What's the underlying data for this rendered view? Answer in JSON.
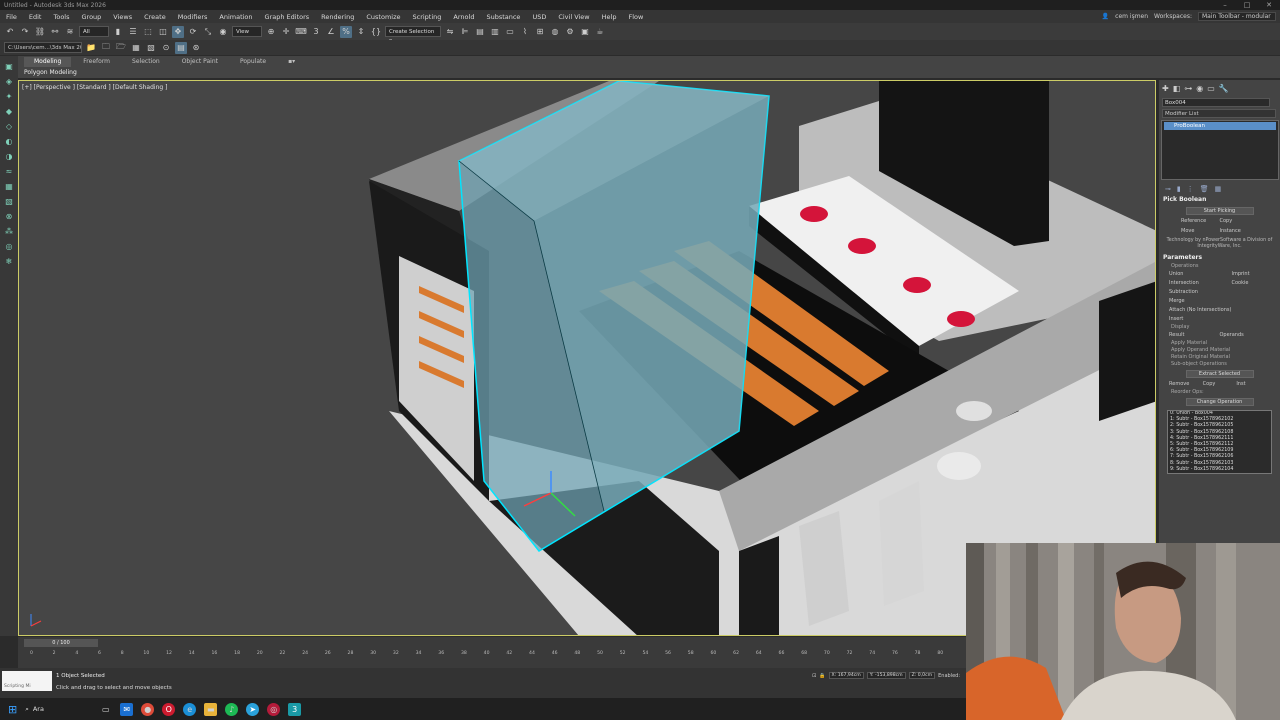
{
  "window": {
    "title": "Untitled - Autodesk 3ds Max 2026",
    "controls": [
      "–",
      "□",
      "✕"
    ]
  },
  "menu": {
    "items": [
      "File",
      "Edit",
      "Tools",
      "Group",
      "Views",
      "Create",
      "Modifiers",
      "Animation",
      "Graph Editors",
      "Rendering",
      "Customize",
      "Scripting",
      "Arnold",
      "Substance",
      "USD",
      "Civil View",
      "Help",
      "Flow"
    ],
    "user": "cem işmen",
    "workspaces_label": "Workspaces:",
    "workspace": "Main Toolbar - modular"
  },
  "toolbar": {
    "filter": "All",
    "ref_coord": "View",
    "selection_set": "Create Selection Se"
  },
  "toolbar2": {
    "path": "C:\\Users\\cem...\\3ds Max 2026"
  },
  "ribbon": {
    "tabs": [
      "Modeling",
      "Freeform",
      "Selection",
      "Object Paint",
      "Populate"
    ],
    "sub_label": "Polygon Modeling"
  },
  "viewport": {
    "label": "[+] [Perspective ] [Standard ] [Default Shading ]"
  },
  "command_panel": {
    "object_name": "Box004",
    "modifier_list": "Modifier List",
    "stack_item": "ProBoolean",
    "pick_boolean": {
      "title": "Pick Boolean",
      "start_picking": "Start Picking",
      "options": [
        "Reference",
        "Copy",
        "Move",
        "Instance"
      ],
      "note": "Technology by nPowerSoftware a Division of IntegrityWare, Inc."
    },
    "parameters": {
      "title": "Parameters",
      "operations_label": "Operations",
      "operations": [
        "Union",
        "Imprint",
        "Intersection",
        "Cookie",
        "Subtraction",
        "",
        "Merge",
        "",
        "Attach (No Intersections)",
        "",
        "Insert",
        ""
      ],
      "display_label": "Display",
      "display": [
        "Result",
        "Operands"
      ],
      "apply_material_label": "Apply Material",
      "apply_material": [
        "Apply Operand Material",
        "Retain Original Material"
      ],
      "subobject_label": "Sub-object Operations",
      "extract_selected": "Extract Selected",
      "extract_opts": [
        "Remove",
        "Copy",
        "Inst"
      ],
      "reorder_ops": "Reorder Ops:",
      "change_operation": "Change Operation",
      "op_list": [
        "0: Union - Box004",
        "1: Subtr - Box1578962102",
        "2: Subtr - Box1578962105",
        "3: Subtr - Box1578962108",
        "4: Subtr - Box1578962111",
        "5: Subtr - Box1578962112",
        "6: Subtr - Box1578962109",
        "7: Subtr - Box1578962106",
        "8: Subtr - Box1578962103",
        "9: Subtr - Box1578962104"
      ]
    }
  },
  "timeline": {
    "slider": "0 / 100",
    "ticks": [
      "0",
      "2",
      "4",
      "6",
      "8",
      "10",
      "12",
      "14",
      "16",
      "18",
      "20",
      "22",
      "24",
      "26",
      "28",
      "30",
      "32",
      "34",
      "36",
      "38",
      "40",
      "42",
      "44",
      "46",
      "48",
      "50",
      "52",
      "54",
      "56",
      "58",
      "60",
      "62",
      "64",
      "66",
      "68",
      "70",
      "72",
      "74",
      "76",
      "78",
      "80"
    ]
  },
  "status": {
    "maxscript": "Scripting Mi",
    "selected": "1 Object Selected",
    "prompt": "Click and drag to select and move objects",
    "x": "X: 167,94cm",
    "y": "Y: -153,898cm",
    "z": "Z: 0,0cm",
    "enabled": "Enabled:"
  },
  "taskbar": {
    "search": "Ara"
  },
  "colors": {
    "accent": "#5a8fc8",
    "selection_outline": "#00e5ff",
    "wood": "#d97a2f",
    "chair_red": "#d4143a"
  }
}
